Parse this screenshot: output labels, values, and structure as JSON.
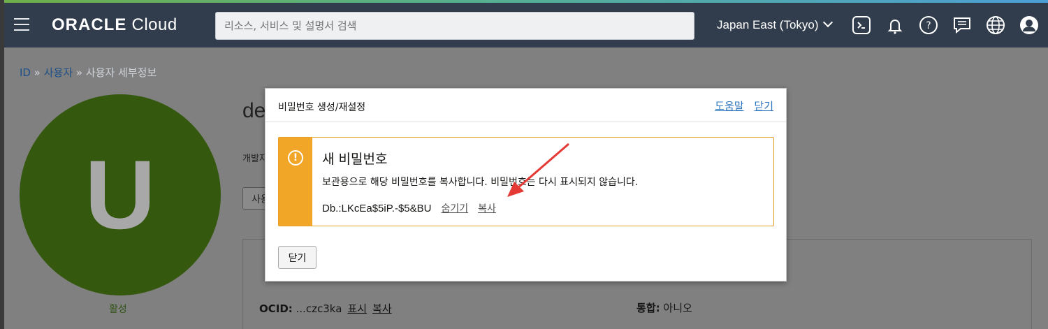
{
  "header": {
    "logo_brand": "ORACLE",
    "logo_product": "Cloud",
    "search_placeholder": "리소스, 서비스 및 설명서 검색",
    "region": "Japan East (Tokyo)",
    "icons": [
      "menu-icon",
      "cloud-shell-icon",
      "bell-icon",
      "help-icon",
      "chat-icon",
      "globe-icon",
      "user-icon"
    ]
  },
  "breadcrumb": {
    "items": [
      {
        "label": "ID",
        "link": true
      },
      {
        "label": "사용자",
        "link": true
      },
      {
        "label": "사용자 세부정보",
        "link": false
      }
    ],
    "separator": "»"
  },
  "user": {
    "avatar_letter": "U",
    "status": "활성",
    "name_partial": "de",
    "desc_partial": "개발자",
    "button_partial": "사용"
  },
  "details": {
    "ocid_label": "OCID:",
    "ocid_value": "...czc3ka",
    "show_link": "표시",
    "copy_link": "복사",
    "federated_label": "통합:",
    "federated_value": "아니오"
  },
  "modal": {
    "title": "비밀번호 생성/재설정",
    "help_link": "도움말",
    "close_link": "닫기",
    "alert": {
      "title": "새 비밀번호",
      "message": "보관용으로 해당 비밀번호를 복사합니다. 비밀번호는 다시 표시되지 않습니다.",
      "password": "Db.:LKcEa$5iP.-$5&BU",
      "hide_link": "숨기기",
      "copy_link": "복사"
    },
    "close_button": "닫기"
  },
  "colors": {
    "header_bg": "#313d4c",
    "alert_accent": "#f2a628",
    "link": "#2f77bf",
    "annotation_arrow": "#e53935"
  }
}
